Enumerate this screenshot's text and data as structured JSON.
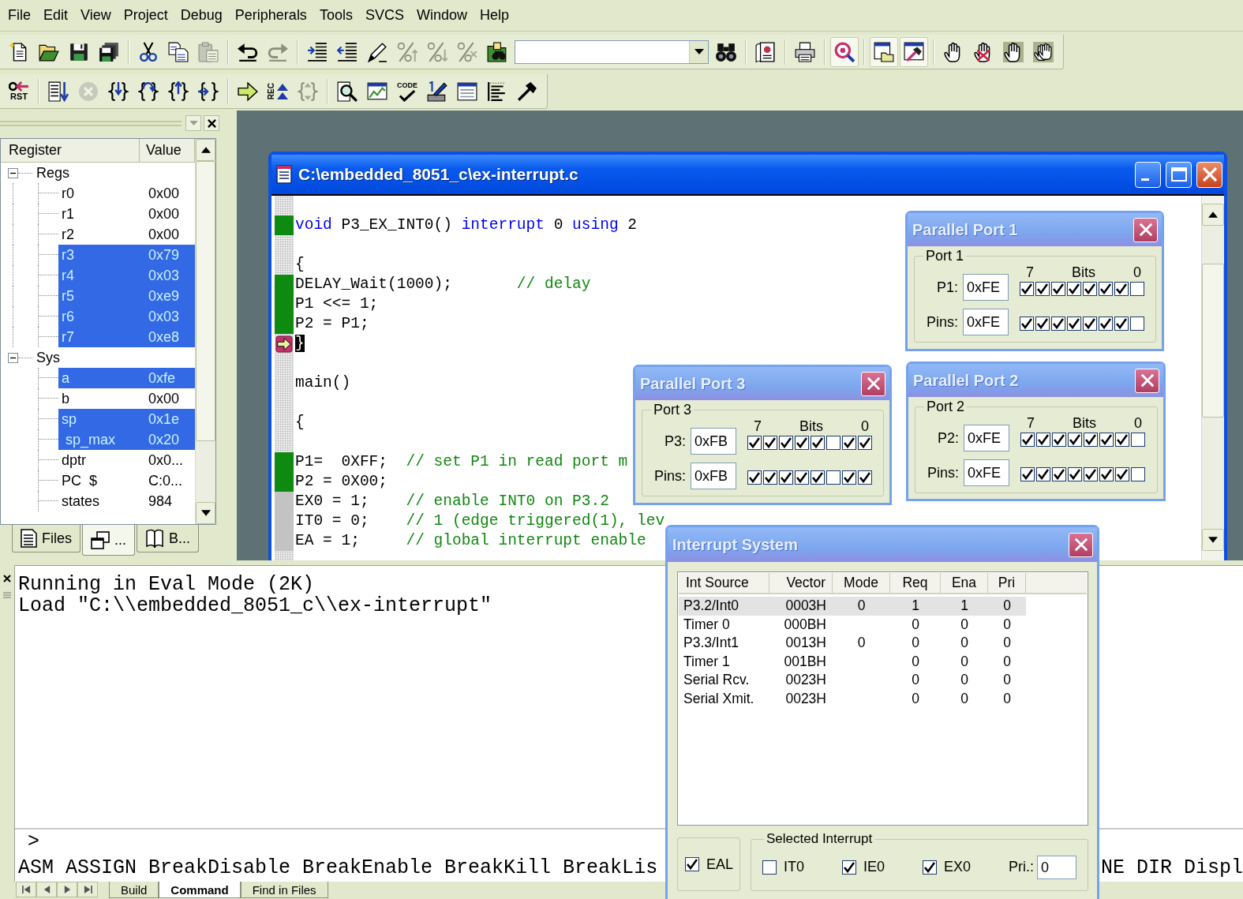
{
  "menu_bar": [
    {
      "label": "File"
    },
    {
      "label": "Edit"
    },
    {
      "label": "View"
    },
    {
      "label": "Project"
    },
    {
      "label": "Debug"
    },
    {
      "label": "Peripherals"
    },
    {
      "label": "Tools"
    },
    {
      "label": "SVCS"
    },
    {
      "label": "Window"
    },
    {
      "label": "Help"
    }
  ],
  "toolbar_1": [
    {
      "kind": "button",
      "disabled": false,
      "pressed": false
    },
    {
      "kind": "button",
      "disabled": false,
      "pressed": false
    },
    {
      "kind": "button",
      "disabled": false,
      "pressed": false
    },
    {
      "kind": "button",
      "disabled": false,
      "pressed": false
    },
    {
      "kind": "separator"
    },
    {
      "kind": "button",
      "disabled": false,
      "pressed": false
    },
    {
      "kind": "button",
      "disabled": false,
      "pressed": false
    },
    {
      "kind": "button",
      "disabled": true,
      "pressed": false
    },
    {
      "kind": "separator"
    },
    {
      "kind": "button",
      "disabled": false,
      "pressed": false
    },
    {
      "kind": "button",
      "disabled": true,
      "pressed": false
    },
    {
      "kind": "separator"
    },
    {
      "kind": "button",
      "disabled": false,
      "pressed": false
    },
    {
      "kind": "button",
      "disabled": false,
      "pressed": false
    },
    {
      "kind": "button",
      "disabled": false,
      "pressed": false
    },
    {
      "kind": "button",
      "disabled": true,
      "pressed": false
    },
    {
      "kind": "button",
      "disabled": true,
      "pressed": false
    },
    {
      "kind": "button",
      "disabled": true,
      "pressed": false
    },
    {
      "kind": "button",
      "disabled": false,
      "pressed": false
    },
    {
      "kind": "combo"
    },
    {
      "kind": "button",
      "disabled": false,
      "pressed": false
    },
    {
      "kind": "separator"
    },
    {
      "kind": "button",
      "disabled": false,
      "pressed": false
    },
    {
      "kind": "separator"
    },
    {
      "kind": "button",
      "disabled": false,
      "pressed": false
    },
    {
      "kind": "separator"
    },
    {
      "kind": "button",
      "disabled": false,
      "pressed": true
    },
    {
      "kind": "separator"
    },
    {
      "kind": "button",
      "disabled": false,
      "pressed": true
    },
    {
      "kind": "button",
      "disabled": false,
      "pressed": true
    },
    {
      "kind": "separator"
    },
    {
      "kind": "button",
      "disabled": false,
      "pressed": false
    },
    {
      "kind": "button",
      "disabled": false,
      "pressed": false
    },
    {
      "kind": "button",
      "disabled": false,
      "pressed": false
    },
    {
      "kind": "button",
      "disabled": false,
      "pressed": false
    }
  ],
  "toolbar_2": [
    {
      "kind": "button",
      "label": "RST",
      "disabled": false
    },
    {
      "kind": "separator"
    },
    {
      "kind": "button",
      "disabled": false
    },
    {
      "kind": "button",
      "disabled": true
    },
    {
      "kind": "button",
      "disabled": false
    },
    {
      "kind": "button",
      "disabled": false
    },
    {
      "kind": "button",
      "disabled": false
    },
    {
      "kind": "button",
      "disabled": false
    },
    {
      "kind": "separator"
    },
    {
      "kind": "button",
      "disabled": false
    },
    {
      "kind": "button",
      "label": "REC",
      "disabled": false
    },
    {
      "kind": "button",
      "disabled": true
    },
    {
      "kind": "separator"
    },
    {
      "kind": "button",
      "disabled": false
    },
    {
      "kind": "button",
      "disabled": false
    },
    {
      "kind": "button",
      "label": "CODE",
      "disabled": false
    },
    {
      "kind": "button",
      "disabled": false
    },
    {
      "kind": "button",
      "disabled": false
    },
    {
      "kind": "button",
      "disabled": false
    },
    {
      "kind": "button",
      "disabled": false
    }
  ],
  "register_panel": {
    "columns": [
      "Register",
      "Value"
    ],
    "tree": [
      {
        "label": "Regs",
        "expanded": true,
        "children": [
          {
            "name": "r0",
            "value": "0x00",
            "highlighted": false
          },
          {
            "name": "r1",
            "value": "0x00",
            "highlighted": false
          },
          {
            "name": "r2",
            "value": "0x00",
            "highlighted": false
          },
          {
            "name": "r3",
            "value": "0x79",
            "highlighted": true
          },
          {
            "name": "r4",
            "value": "0x03",
            "highlighted": true
          },
          {
            "name": "r5",
            "value": "0xe9",
            "highlighted": true
          },
          {
            "name": "r6",
            "value": "0x03",
            "highlighted": true
          },
          {
            "name": "r7",
            "value": "0xe8",
            "highlighted": true
          }
        ]
      },
      {
        "label": "Sys",
        "expanded": true,
        "children": [
          {
            "name": "a",
            "value": "0xfe",
            "highlighted": true
          },
          {
            "name": "b",
            "value": "0x00",
            "highlighted": false
          },
          {
            "name": "sp",
            "value": "0x1e",
            "highlighted": true
          },
          {
            "name": " sp_max",
            "value": "0x20",
            "highlighted": true
          },
          {
            "name": "dptr",
            "value": "0x0...",
            "highlighted": false
          },
          {
            "name": "PC  $",
            "value": "C:0...",
            "highlighted": false
          },
          {
            "name": "states",
            "value": "984",
            "highlighted": false
          }
        ]
      }
    ],
    "tabs": [
      {
        "label": "Files",
        "selected": false
      },
      {
        "label": "...",
        "selected": true
      },
      {
        "label": "B...",
        "selected": false
      }
    ]
  },
  "editor": {
    "title": "C:\\embedded_8051_c\\ex-interrupt.c",
    "lines": [
      {
        "kind": "plain"
      },
      {
        "kind": "executed",
        "current": false,
        "segments": [
          {
            "kind": "keyword",
            "text": "void"
          },
          {
            "kind": "plain",
            "text": " P3_EX_INT0() "
          },
          {
            "kind": "keyword",
            "text": "interrupt"
          },
          {
            "kind": "plain",
            "text": " 0 "
          },
          {
            "kind": "keyword",
            "text": "using"
          },
          {
            "kind": "plain",
            "text": " 2"
          }
        ]
      },
      {
        "kind": "plain"
      },
      {
        "kind": "plain",
        "current": false,
        "segments": [
          {
            "kind": "plain",
            "text": "{"
          }
        ]
      },
      {
        "kind": "executed",
        "current": false,
        "segments": [
          {
            "kind": "plain",
            "text": "DELAY_Wait(1000);       "
          },
          {
            "kind": "comment",
            "text": "// delay"
          }
        ]
      },
      {
        "kind": "executed",
        "current": false,
        "segments": [
          {
            "kind": "plain",
            "text": "P1 <<= 1;"
          }
        ]
      },
      {
        "kind": "executed",
        "current": false,
        "segments": [
          {
            "kind": "plain",
            "text": "P2 = P1;"
          }
        ]
      },
      {
        "kind": "plain",
        "current": true,
        "segments": [
          {
            "kind": "highlight",
            "text": "}"
          }
        ]
      },
      {
        "kind": "plain"
      },
      {
        "kind": "plain",
        "current": false,
        "segments": [
          {
            "kind": "plain",
            "text": "main()"
          }
        ]
      },
      {
        "kind": "plain"
      },
      {
        "kind": "plain",
        "current": false,
        "segments": [
          {
            "kind": "plain",
            "text": "{"
          }
        ]
      },
      {
        "kind": "plain"
      },
      {
        "kind": "executed",
        "current": false,
        "segments": [
          {
            "kind": "plain",
            "text": "P1=  0XFF;  "
          },
          {
            "kind": "comment",
            "text": "// set P1 in read port m"
          }
        ]
      },
      {
        "kind": "executed",
        "current": false,
        "segments": [
          {
            "kind": "plain",
            "text": "P2 = 0X00;"
          }
        ]
      },
      {
        "kind": "skipped",
        "current": false,
        "segments": [
          {
            "kind": "plain",
            "text": "EX0 = 1;    "
          },
          {
            "kind": "comment",
            "text": "// enable INT0 on P3.2"
          }
        ]
      },
      {
        "kind": "skipped",
        "current": false,
        "segments": [
          {
            "kind": "plain",
            "text": "IT0 = 0;    "
          },
          {
            "kind": "comment",
            "text": "// 1 (edge triggered(1), lev"
          }
        ]
      },
      {
        "kind": "skipped",
        "current": false,
        "segments": [
          {
            "kind": "plain",
            "text": "EA = 1;     "
          },
          {
            "kind": "comment",
            "text": "// global interrupt enable"
          }
        ]
      }
    ]
  },
  "parallel_ports": [
    {
      "title": "Parallel Port 1",
      "group": "Port 1",
      "bit_high": "7",
      "bits_label": "Bits",
      "bit_low": "0",
      "rows": [
        {
          "label": "P1:",
          "value": "0xFE",
          "bits": [
            {
              "checked": true
            },
            {
              "checked": true
            },
            {
              "checked": true
            },
            {
              "checked": true
            },
            {
              "checked": true
            },
            {
              "checked": true
            },
            {
              "checked": true
            },
            {
              "checked": false
            }
          ]
        },
        {
          "label": "Pins:",
          "value": "0xFE",
          "bits": [
            {
              "checked": true
            },
            {
              "checked": true
            },
            {
              "checked": true
            },
            {
              "checked": true
            },
            {
              "checked": true
            },
            {
              "checked": true
            },
            {
              "checked": true
            },
            {
              "checked": false
            }
          ]
        }
      ]
    },
    {
      "title": "Parallel Port 3",
      "group": "Port 3",
      "bit_high": "7",
      "bits_label": "Bits",
      "bit_low": "0",
      "rows": [
        {
          "label": "P3:",
          "value": "0xFB",
          "bits": [
            {
              "checked": true
            },
            {
              "checked": true
            },
            {
              "checked": true
            },
            {
              "checked": true
            },
            {
              "checked": true
            },
            {
              "checked": false
            },
            {
              "checked": true
            },
            {
              "checked": true
            }
          ]
        },
        {
          "label": "Pins:",
          "value": "0xFB",
          "bits": [
            {
              "checked": true
            },
            {
              "checked": true
            },
            {
              "checked": true
            },
            {
              "checked": true
            },
            {
              "checked": true
            },
            {
              "checked": false
            },
            {
              "checked": true
            },
            {
              "checked": true
            }
          ]
        }
      ]
    },
    {
      "title": "Parallel Port 2",
      "group": "Port 2",
      "bit_high": "7",
      "bits_label": "Bits",
      "bit_low": "0",
      "rows": [
        {
          "label": "P2:",
          "value": "0xFE",
          "bits": [
            {
              "checked": true
            },
            {
              "checked": true
            },
            {
              "checked": true
            },
            {
              "checked": true
            },
            {
              "checked": true
            },
            {
              "checked": true
            },
            {
              "checked": true
            },
            {
              "checked": false
            }
          ]
        },
        {
          "label": "Pins:",
          "value": "0xFE",
          "bits": [
            {
              "checked": true
            },
            {
              "checked": true
            },
            {
              "checked": true
            },
            {
              "checked": true
            },
            {
              "checked": true
            },
            {
              "checked": true
            },
            {
              "checked": true
            },
            {
              "checked": false
            }
          ]
        }
      ]
    }
  ],
  "interrupt_system": {
    "title": "Interrupt System",
    "columns": [
      "Int Source",
      "Vector",
      "Mode",
      "Req",
      "Ena",
      "Pri"
    ],
    "rows": [
      {
        "selected": true,
        "source": "P3.2/Int0",
        "vector": "0003H",
        "mode": "0",
        "req": "1",
        "ena": "1",
        "pri": "0"
      },
      {
        "selected": false,
        "source": "Timer 0",
        "vector": "000BH",
        "req": "0",
        "ena": "0",
        "pri": "0"
      },
      {
        "selected": false,
        "source": "P3.3/Int1",
        "vector": "0013H",
        "mode": "0",
        "req": "0",
        "ena": "0",
        "pri": "0"
      },
      {
        "selected": false,
        "source": "Timer 1",
        "vector": "001BH",
        "req": "0",
        "ena": "0",
        "pri": "0"
      },
      {
        "selected": false,
        "source": "Serial Rcv.",
        "vector": "0023H",
        "req": "0",
        "ena": "0",
        "pri": "0"
      },
      {
        "selected": false,
        "source": "Serial Xmit.",
        "vector": "0023H",
        "req": "0",
        "ena": "0",
        "pri": "0"
      }
    ],
    "eal": {
      "label": "EAL",
      "checked": true
    },
    "selected_interrupt": {
      "title": "Selected Interrupt",
      "checks": [
        {
          "label": "IT0",
          "checked": false
        },
        {
          "label": "IE0",
          "checked": true
        },
        {
          "label": "EX0",
          "checked": true
        }
      ],
      "priority": {
        "label": "Pri.:",
        "value": "0"
      }
    }
  },
  "output": {
    "lines": [
      "Running in Eval Mode (2K)",
      "Load \"C:\\\\embedded_8051_c\\\\ex-interrupt\""
    ],
    "prompt": ">",
    "command_help": {
      "left": "ASM ASSIGN BreakDisable BreakEnable BreakKill BreakLis",
      "right": "NE DIR Displ"
    },
    "tabs": [
      {
        "label": "Build",
        "selected": false
      },
      {
        "label": "Command",
        "selected": true
      },
      {
        "label": "Find in Files",
        "selected": false
      }
    ]
  }
}
